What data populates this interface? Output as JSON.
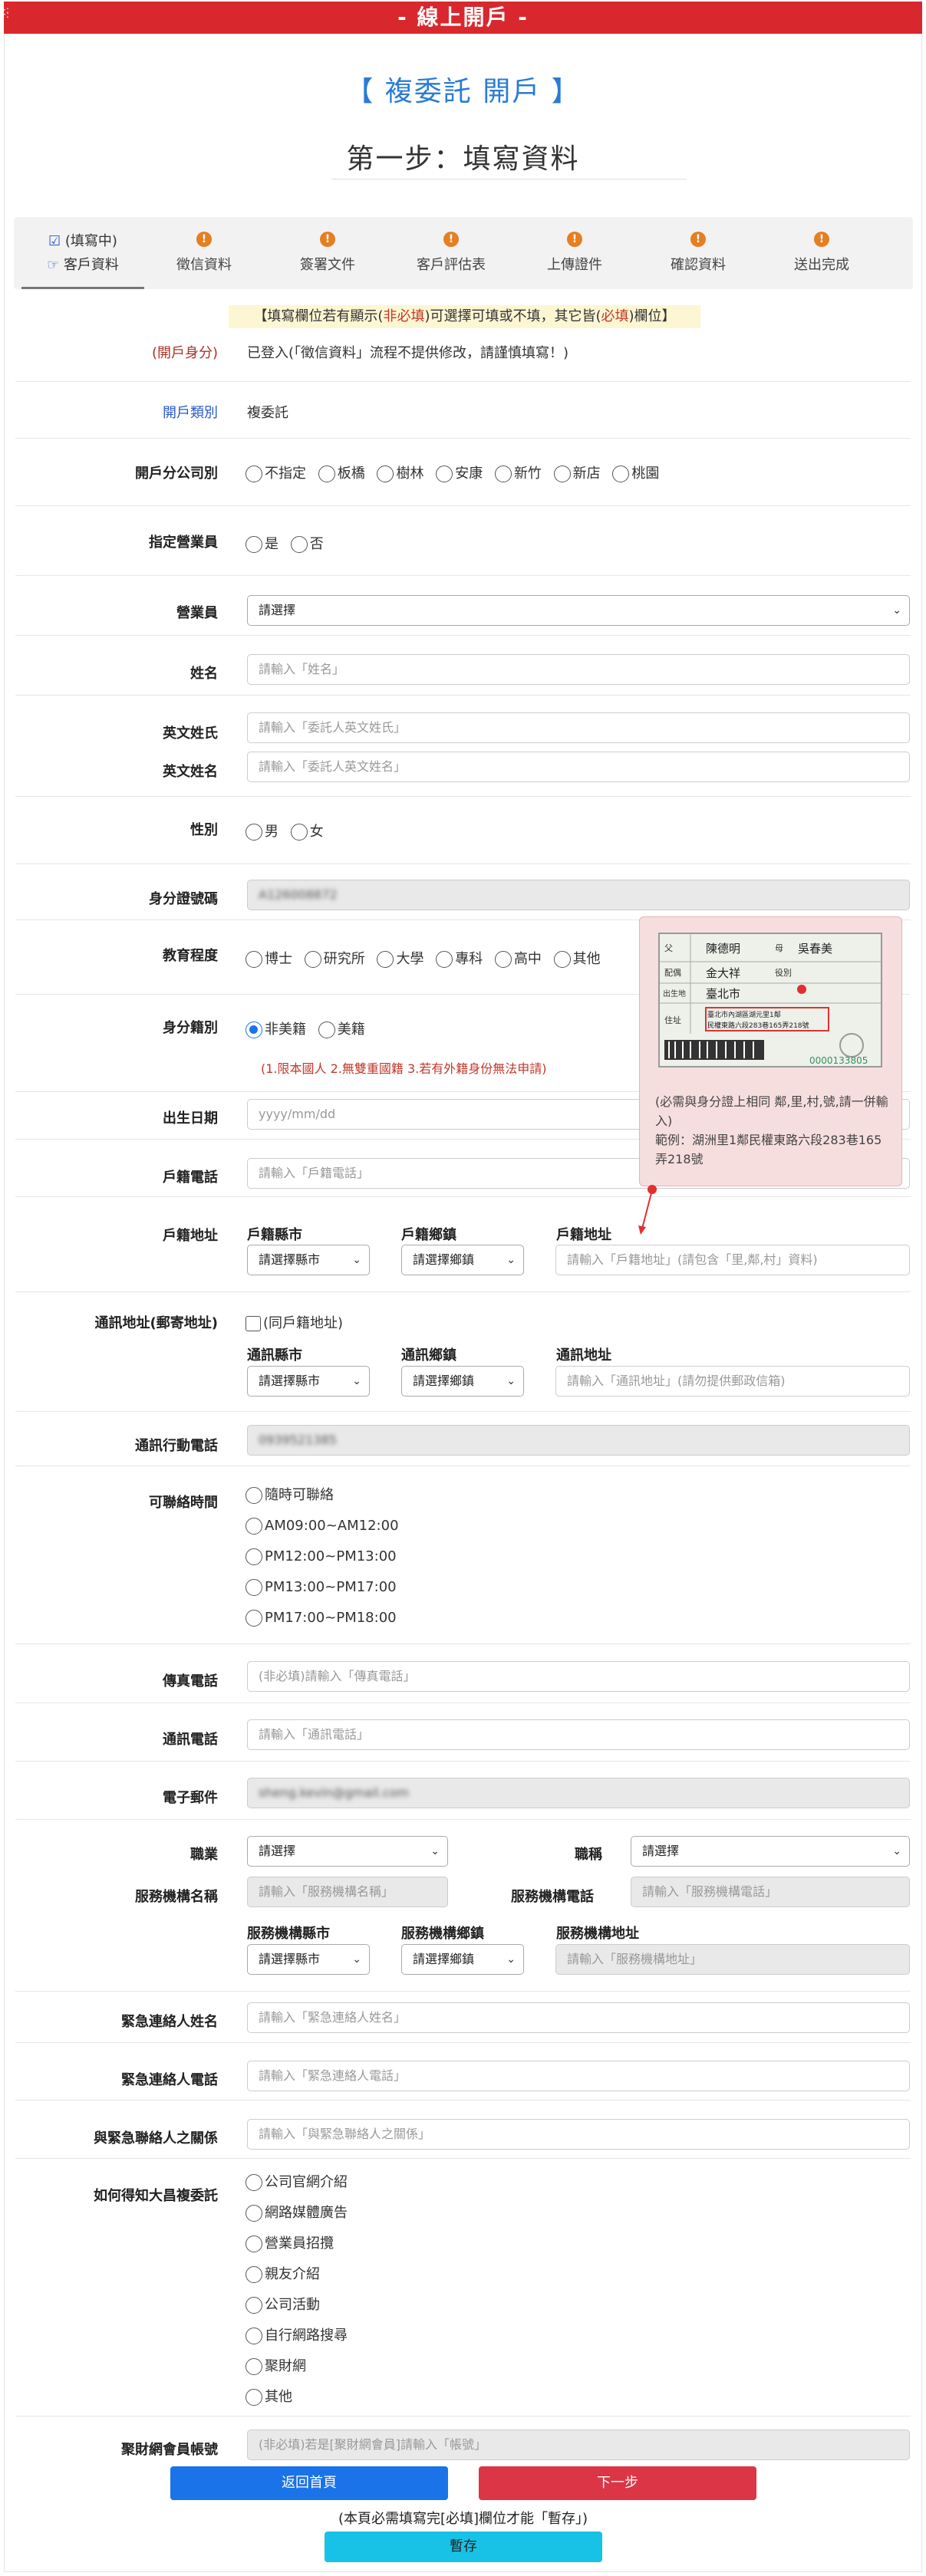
{
  "top_title": "- 線上開戶 -",
  "title": "【 複委託 開戶 】",
  "step_title": "第一步：填寫資料",
  "tabs": [
    {
      "status": "(填寫中)",
      "label": "客戶資料"
    },
    {
      "label": "徵信資料"
    },
    {
      "label": "簽署文件"
    },
    {
      "label": "客戶評估表"
    },
    {
      "label": "上傳證件"
    },
    {
      "label": "確認資料"
    },
    {
      "label": "送出完成"
    }
  ],
  "notice": {
    "a": "【填寫欄位若有顯示(",
    "b": "非必填",
    "c": ")可選擇可填或不填，其它皆(",
    "d": "必填",
    "e": ")欄位】"
  },
  "identity": {
    "label": "(開戶身分)",
    "value": "已登入(「徵信資料」流程不提供修改，請謹慎填寫！)"
  },
  "type": {
    "label": "開戶類別",
    "value": "複委託"
  },
  "branch": {
    "label": "開戶分公司別",
    "options": [
      "不指定",
      "板橋",
      "樹林",
      "安康",
      "新竹",
      "新店",
      "桃園"
    ]
  },
  "assign": {
    "label": "指定營業員",
    "options": [
      "是",
      "否"
    ]
  },
  "agent": {
    "label": "營業員",
    "placeholder": "請選擇"
  },
  "name": {
    "label": "姓名",
    "placeholder": "請輸入「姓名」"
  },
  "en_last": {
    "label": "英文姓氏",
    "placeholder": "請輸入「委託人英文姓氏」"
  },
  "en_first": {
    "label": "英文姓名",
    "placeholder": "請輸入「委託人英文姓名」"
  },
  "gender": {
    "label": "性別",
    "options": [
      "男",
      "女"
    ]
  },
  "idno": {
    "label": "身分證號碼",
    "value": "A126008872"
  },
  "edu": {
    "label": "教育程度",
    "options": [
      "博士",
      "研究所",
      "大學",
      "專科",
      "高中",
      "其他"
    ]
  },
  "nationality": {
    "label": "身分籍別",
    "options": [
      "非美籍",
      "美籍"
    ],
    "note": "(1.限本國人 2.無雙重國籍 3.若有外籍身份無法申請)"
  },
  "birth": {
    "label": "出生日期",
    "placeholder": "yyyy/mm/dd"
  },
  "home_tel": {
    "label": "戶籍電話",
    "placeholder": "請輸入「戶籍電話」"
  },
  "home_addr": {
    "label": "戶籍地址",
    "city_label": "戶籍縣市",
    "town_label": "戶籍鄉鎮",
    "addr_label": "戶籍地址",
    "city": "請選擇縣市",
    "town": "請選擇鄉鎮",
    "placeholder": "請輸入「戶籍地址」(請包含「里,鄰,村」資料)"
  },
  "popup": {
    "card": {
      "father_l": "父",
      "father": "陳德明",
      "mother_l": "母",
      "mother": "吳春美",
      "spouse_l": "配偶",
      "spouse": "金大祥",
      "service_l": "役別",
      "birth_l": "出生地",
      "birth": "臺北市",
      "addr_l": "住址",
      "addr1": "臺北市內湖區湖元里1鄰",
      "addr2": "民權東路六段283巷165弄218號",
      "no": "0000133805"
    },
    "text1": "(必需與身分證上相同 鄰,里,村,號,請一併輸入)",
    "text2": "範例：湖洲里1鄰民權東路六段283巷165弄218號"
  },
  "mail_addr": {
    "label": "通訊地址(郵寄地址)",
    "same": "(同戶籍地址)",
    "city_label": "通訊縣市",
    "town_label": "通訊鄉鎮",
    "addr_label": "通訊地址",
    "city": "請選擇縣市",
    "town": "請選擇鄉鎮",
    "placeholder": "請輸入「通訊地址」(請勿提供郵政信箱)"
  },
  "mobile": {
    "label": "通訊行動電話",
    "value": "0939521385"
  },
  "contact_time": {
    "label": "可聯絡時間",
    "options": [
      "隨時可聯絡",
      "AM09:00~AM12:00",
      "PM12:00~PM13:00",
      "PM13:00~PM17:00",
      "PM17:00~PM18:00"
    ]
  },
  "fax": {
    "label": "傳真電話",
    "placeholder": "(非必填)請輸入「傳真電話」"
  },
  "tel": {
    "label": "通訊電話",
    "placeholder": "請輸入「通訊電話」"
  },
  "email": {
    "label": "電子郵件",
    "value": "sheng.kevin@gmail.com"
  },
  "job": {
    "label": "職業",
    "placeholder": "請選擇",
    "title_label": "職稱",
    "title_placeholder": "請選擇",
    "org_label": "服務機構名稱",
    "org_placeholder": "請輸入「服務機構名稱」",
    "org_tel_label": "服務機構電話",
    "org_tel_placeholder": "請輸入「服務機構電話」",
    "org_city_label": "服務機構縣市",
    "org_town_label": "服務機構鄉鎮",
    "org_addr_label": "服務機構地址",
    "org_city": "請選擇縣市",
    "org_town": "請選擇鄉鎮",
    "org_addr_placeholder": "請輸入「服務機構地址」"
  },
  "em_name": {
    "label": "緊急連絡人姓名",
    "placeholder": "請輸入「緊急連絡人姓名」"
  },
  "em_tel": {
    "label": "緊急連絡人電話",
    "placeholder": "請輸入「緊急連絡人電話」"
  },
  "em_rel": {
    "label": "與緊急聯絡人之關係",
    "placeholder": "請輸入「與緊急聯絡人之關係」"
  },
  "source": {
    "label": "如何得知大昌複委託",
    "options": [
      "公司官網介紹",
      "網路媒體廣告",
      "營業員招攬",
      "親友介紹",
      "公司活動",
      "自行網路搜尋",
      "聚財網",
      "其他"
    ]
  },
  "jucai": {
    "label": "聚財網會員帳號",
    "placeholder": "(非必填)若是[聚財網會員]請輸入「帳號」"
  },
  "buttons": {
    "home": "返回首頁",
    "next": "下一步",
    "save_note": "(本頁必需填寫完[必填]欄位才能「暫存」)",
    "save": "暫存"
  },
  "colors": {
    "topbar": "#d8282e",
    "title": "#2b7bd4",
    "home_btn": "#1a73e8",
    "next_btn": "#dc3545",
    "save_btn": "#17c2e6"
  }
}
